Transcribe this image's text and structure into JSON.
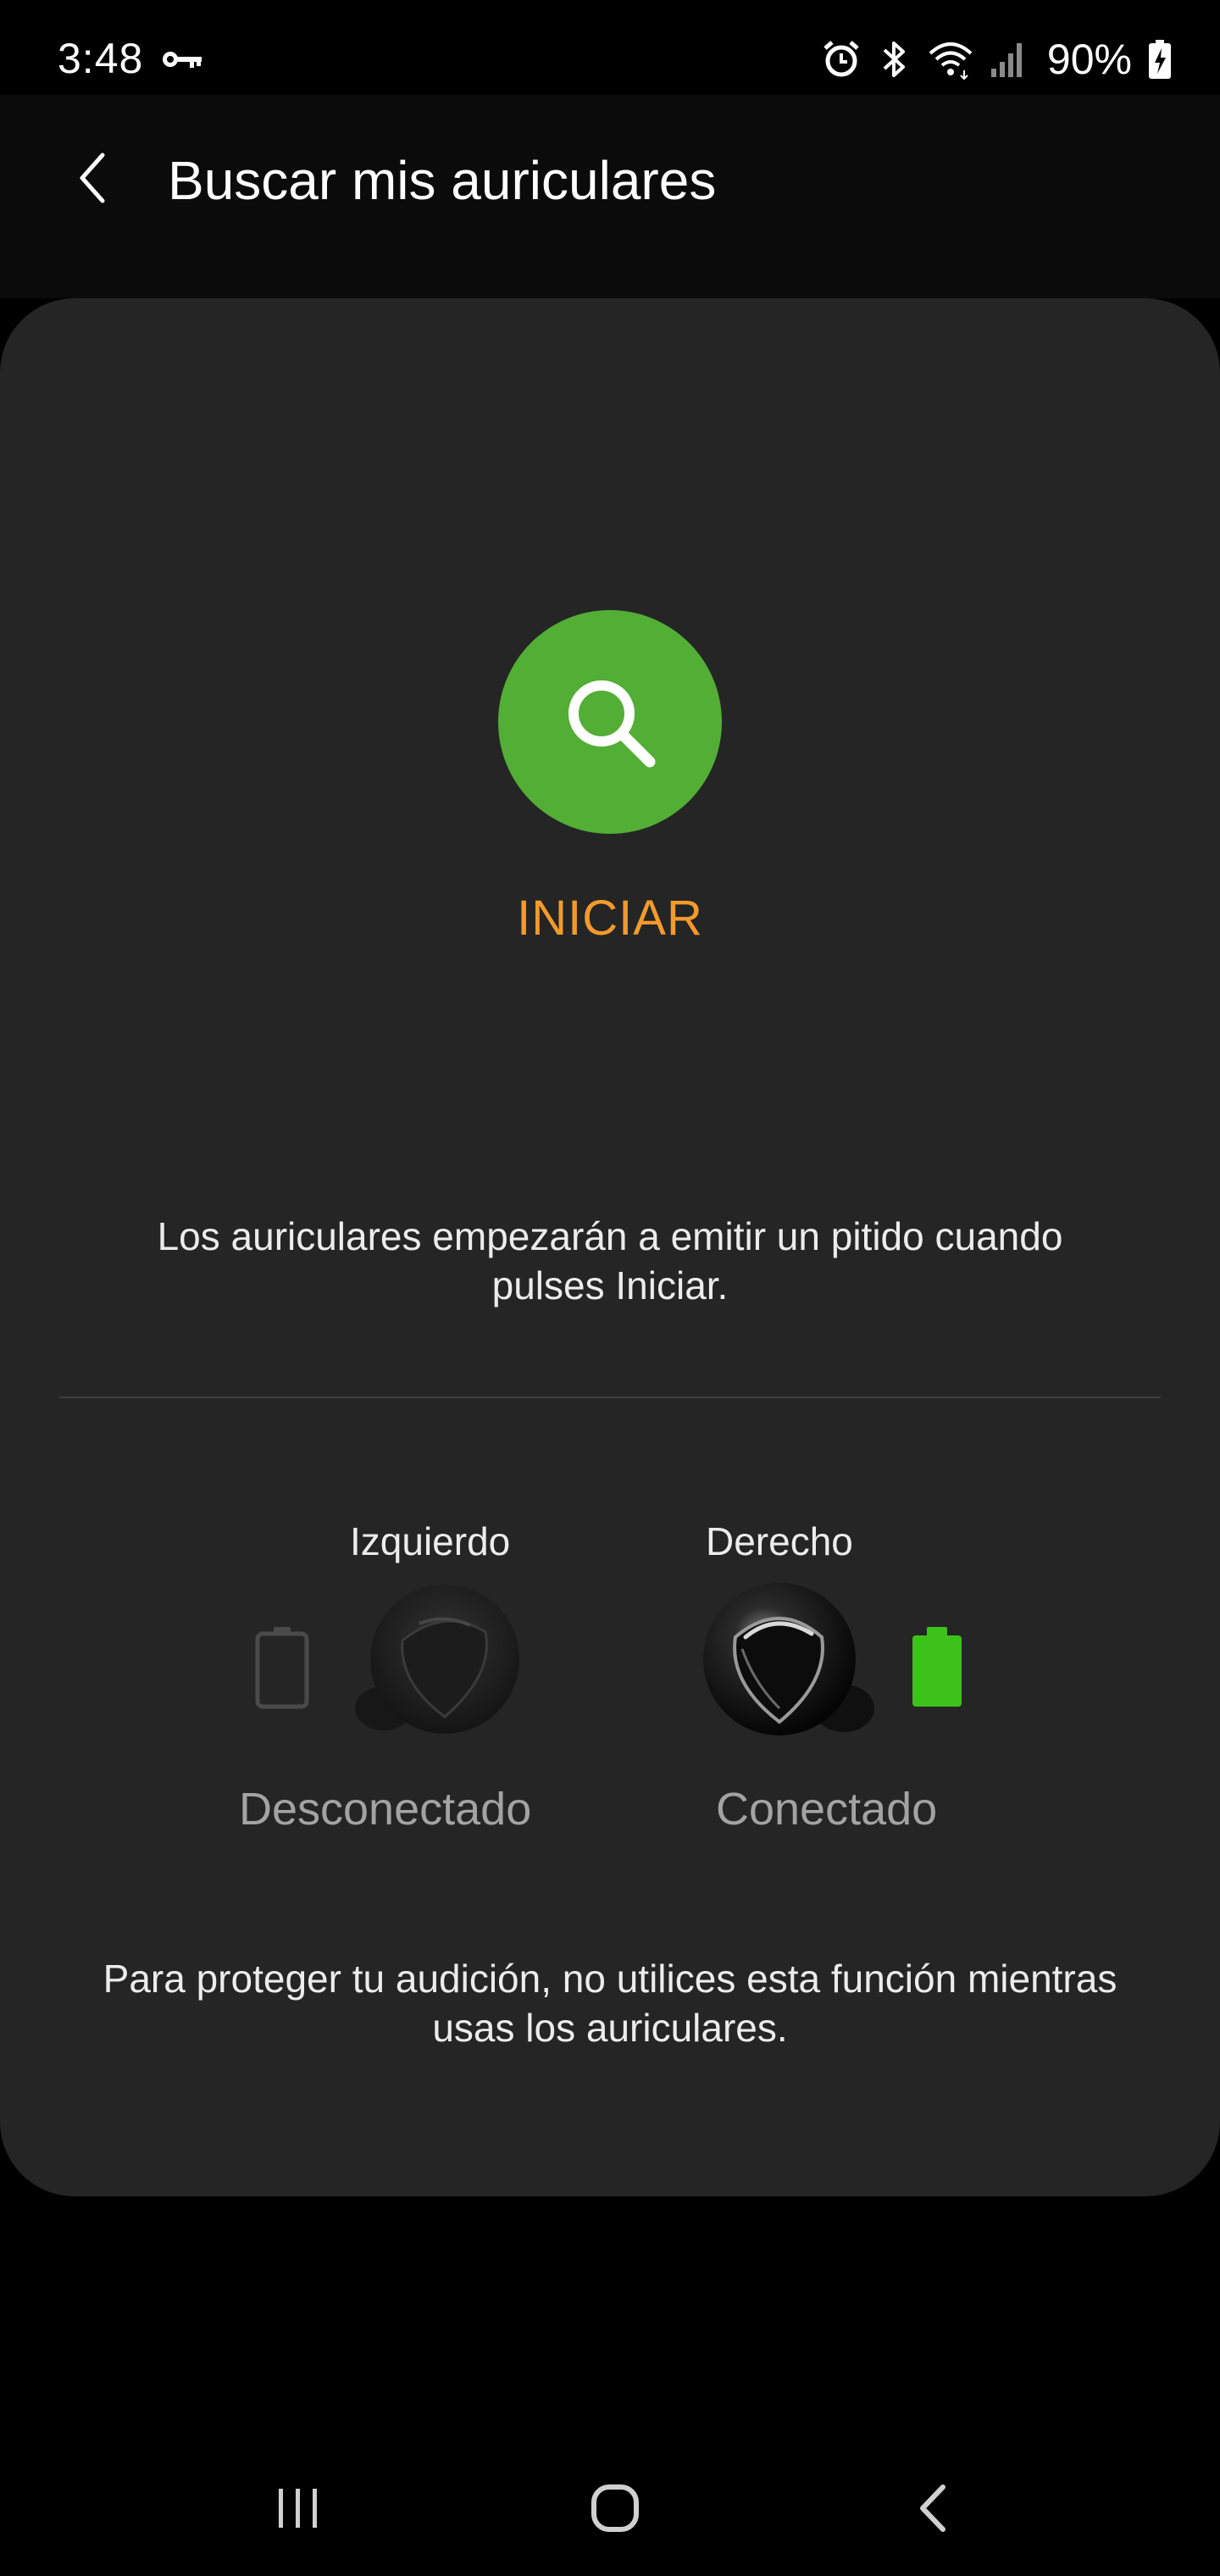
{
  "status_bar": {
    "time": "3:48",
    "battery_percent": "90%",
    "icons": [
      "vpn-key-icon",
      "alarm-icon",
      "bluetooth-icon",
      "wifi-icon",
      "signal-icon",
      "battery-charging-icon"
    ]
  },
  "header": {
    "title": "Buscar mis auriculares",
    "back_icon": "back-arrow-icon"
  },
  "search": {
    "icon": "search-icon",
    "button_color": "#53ae36",
    "start_label": "INICIAR",
    "start_color": "#f39a2c"
  },
  "info_text": "Los auriculares empezarán a emitir un pitido cuando pulses Iniciar.",
  "earbuds": {
    "left": {
      "label": "Izquierdo",
      "status": "Desconectado",
      "connected": false,
      "battery_icon": "battery-empty-icon"
    },
    "right": {
      "label": "Derecho",
      "status": "Conectado",
      "connected": true,
      "battery_icon": "battery-full-icon",
      "battery_color": "#3dc21b"
    }
  },
  "warning_text": "Para proteger tu audición, no utilices esta función mientras usas los auriculares.",
  "nav_bar": {
    "icons": [
      "recents-icon",
      "home-icon",
      "back-icon"
    ]
  }
}
